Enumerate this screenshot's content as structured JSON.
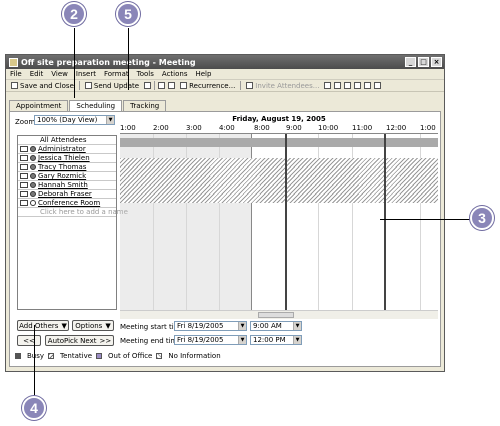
{
  "callouts": {
    "c2": "2",
    "c5": "5",
    "c3": "3",
    "c4": "4"
  },
  "window": {
    "title": "Off site preparation meeting - Meeting",
    "controls": {
      "minimize": "_",
      "maximize": "□",
      "close": "×"
    }
  },
  "menu": [
    "File",
    "Edit",
    "View",
    "Insert",
    "Format",
    "Tools",
    "Actions",
    "Help"
  ],
  "toolbar": {
    "save_close": "Save and Close",
    "send_update": "Send Update",
    "recurrence": "Recurrence...",
    "invite": "Invite Attendees..."
  },
  "tabs": [
    "Appointment",
    "Scheduling",
    "Tracking"
  ],
  "zoom": {
    "label": "Zoom:",
    "value": "100% (Day View)"
  },
  "grid": {
    "date": "Friday, August 19, 2005",
    "times": [
      "1:00",
      "2:00",
      "3:00",
      "4:00",
      "8:00",
      "9:00",
      "10:00",
      "11:00",
      "12:00",
      "1:00"
    ]
  },
  "attendees": {
    "header": "All Attendees",
    "people": [
      "Administrator",
      "Jessica Thielen",
      "Tracy Thomas",
      "Gary Rozmick",
      "Hannah Smith",
      "Deborah Fraser",
      "Conference Room"
    ],
    "add_placeholder": "Click here to add a name"
  },
  "buttons": {
    "add_others": "Add Others",
    "options": "Options",
    "back": "<<",
    "autopick": "AutoPick Next",
    "forward": ">>"
  },
  "meeting": {
    "start_label": "Meeting start time:",
    "end_label": "Meeting end time:",
    "start_date": "Fri 8/19/2005",
    "start_time": "9:00 AM",
    "end_date": "Fri 8/19/2005",
    "end_time": "12:00 PM"
  },
  "legend": {
    "busy": "Busy",
    "tentative": "Tentative",
    "out": "Out of Office",
    "noinfo": "No Information"
  }
}
